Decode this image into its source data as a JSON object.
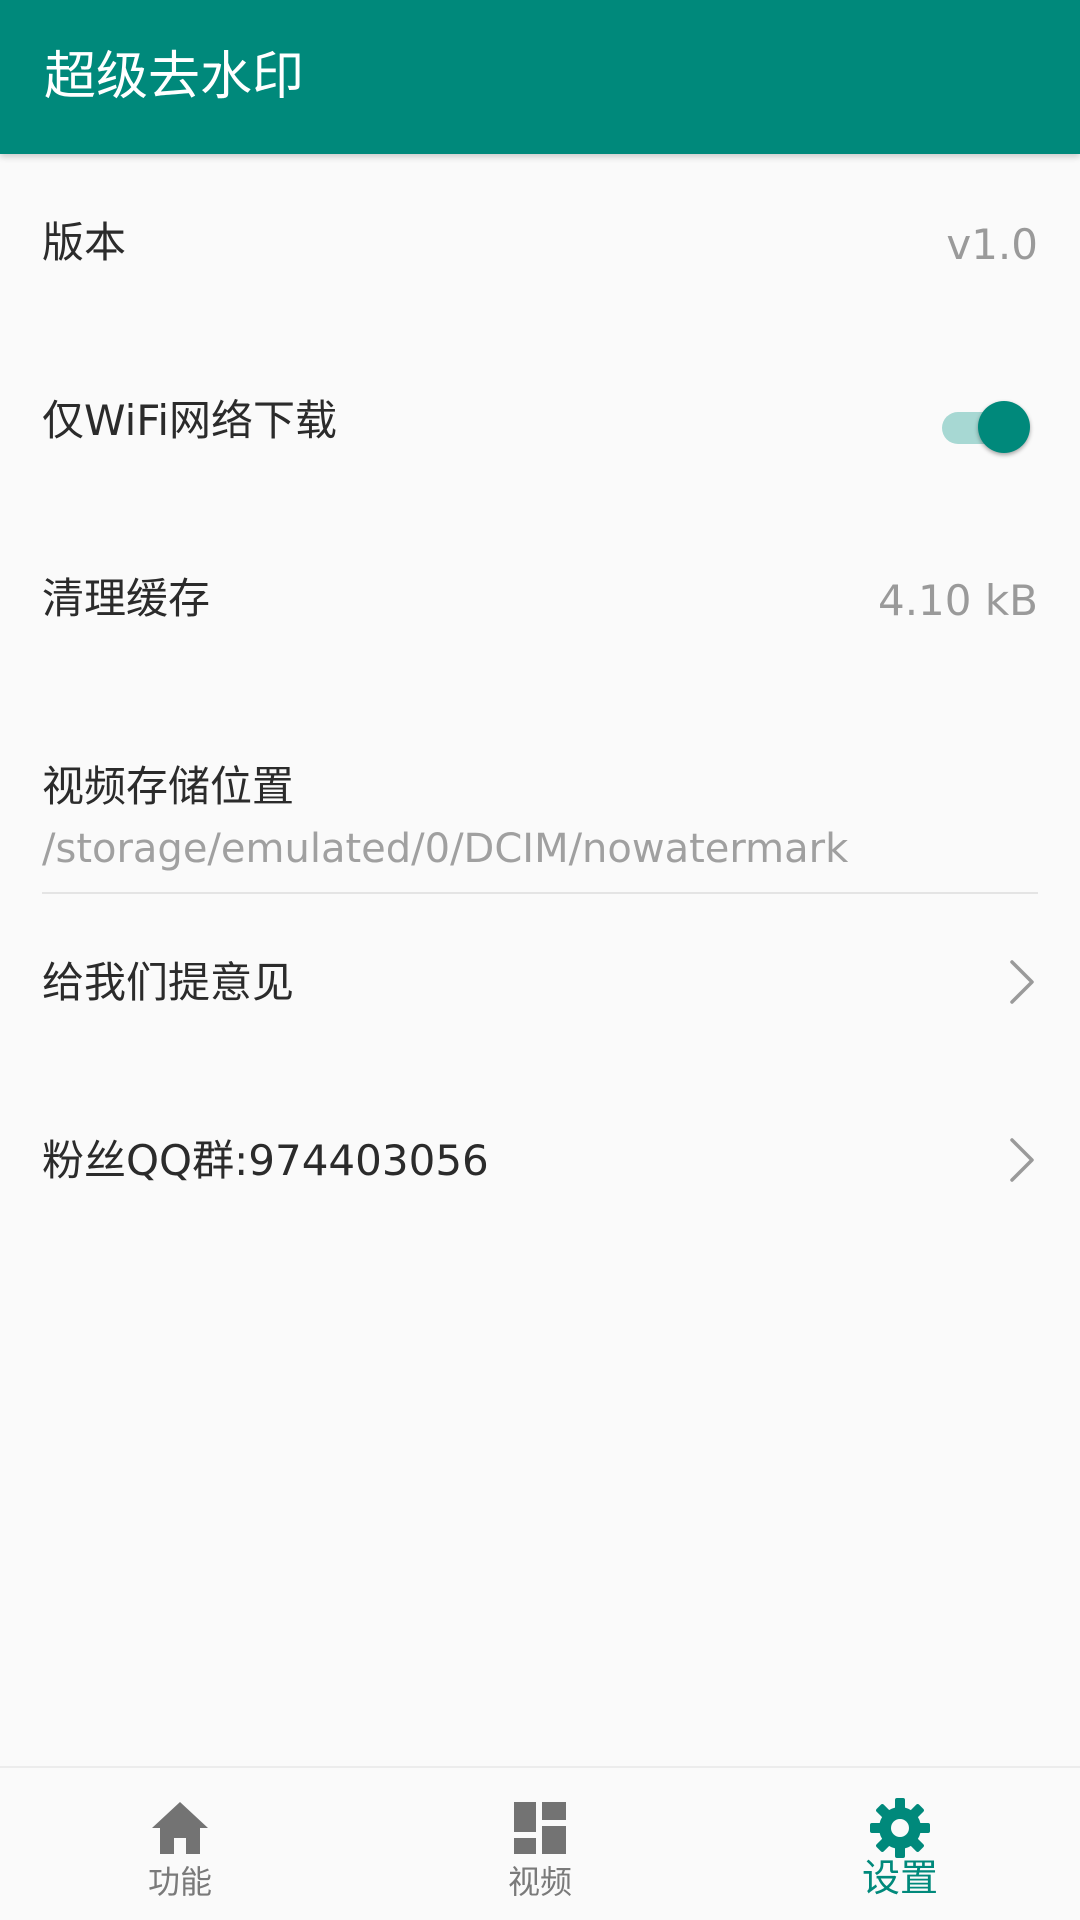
{
  "app": {
    "title": "超级去水印"
  },
  "colors": {
    "primary": "#00897b",
    "toggle_track": "#a7d8d3",
    "text_primary": "#2b2b2b",
    "text_secondary": "#9a9a9a",
    "nav_inactive": "#7a7a7a"
  },
  "settings": {
    "version": {
      "label": "版本",
      "value": "v1.0"
    },
    "wifi_only": {
      "label": "仅WiFi网络下载",
      "enabled": true
    },
    "clear_cache": {
      "label": "清理缓存",
      "value": "4.10 kB"
    },
    "storage_location": {
      "label": "视频存储位置",
      "path": "/storage/emulated/0/DCIM/nowatermark"
    },
    "feedback": {
      "label": "给我们提意见",
      "icon": "chevron-right-icon"
    },
    "qq_group": {
      "label": "粉丝QQ群:974403056",
      "icon": "chevron-right-icon"
    }
  },
  "bottom_nav": {
    "items": [
      {
        "label": "功能",
        "icon": "home-icon",
        "active": false
      },
      {
        "label": "视频",
        "icon": "dashboard-icon",
        "active": false
      },
      {
        "label": "设置",
        "icon": "gear-icon",
        "active": true
      }
    ]
  }
}
